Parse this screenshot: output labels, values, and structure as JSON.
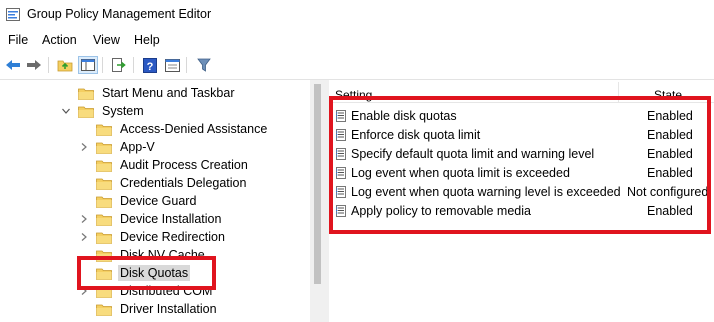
{
  "window": {
    "title": "Group Policy Management Editor"
  },
  "menu": [
    "File",
    "Action",
    "View",
    "Help"
  ],
  "toolbar": {
    "buttons": [
      "back-arrow-icon",
      "forward-arrow-icon",
      "up-folder-icon",
      "show-hide-tree-icon",
      "export-list-icon",
      "help-icon",
      "properties-icon",
      "filter-icon"
    ]
  },
  "tree": {
    "items": [
      {
        "label": "Start Menu and Taskbar",
        "level": 1,
        "expander": "none"
      },
      {
        "label": "System",
        "level": 1,
        "expander": "expanded"
      },
      {
        "label": "Access-Denied Assistance",
        "level": 2,
        "expander": "none"
      },
      {
        "label": "App-V",
        "level": 2,
        "expander": "collapsed"
      },
      {
        "label": "Audit Process Creation",
        "level": 2,
        "expander": "none"
      },
      {
        "label": "Credentials Delegation",
        "level": 2,
        "expander": "none"
      },
      {
        "label": "Device Guard",
        "level": 2,
        "expander": "none"
      },
      {
        "label": "Device Installation",
        "level": 2,
        "expander": "collapsed"
      },
      {
        "label": "Device Redirection",
        "level": 2,
        "expander": "collapsed"
      },
      {
        "label": "Disk NV Cache",
        "level": 2,
        "expander": "none"
      },
      {
        "label": "Disk Quotas",
        "level": 2,
        "expander": "none",
        "selected": true
      },
      {
        "label": "Distributed COM",
        "level": 2,
        "expander": "collapsed"
      },
      {
        "label": "Driver Installation",
        "level": 2,
        "expander": "none"
      }
    ]
  },
  "list": {
    "headers": {
      "setting": "Setting",
      "state": "State"
    },
    "rows": [
      {
        "setting": "Enable disk quotas",
        "state": "Enabled"
      },
      {
        "setting": "Enforce disk quota limit",
        "state": "Enabled"
      },
      {
        "setting": "Specify default quota limit and warning level",
        "state": "Enabled"
      },
      {
        "setting": "Log event when quota limit is exceeded",
        "state": "Enabled"
      },
      {
        "setting": "Log event when quota warning level is exceeded",
        "state": "Not configured"
      },
      {
        "setting": "Apply policy to removable media",
        "state": "Enabled"
      }
    ]
  },
  "colors": {
    "annotation": "#e0141e",
    "selection": "#d9d9d9",
    "folder": "#f4cf62"
  }
}
